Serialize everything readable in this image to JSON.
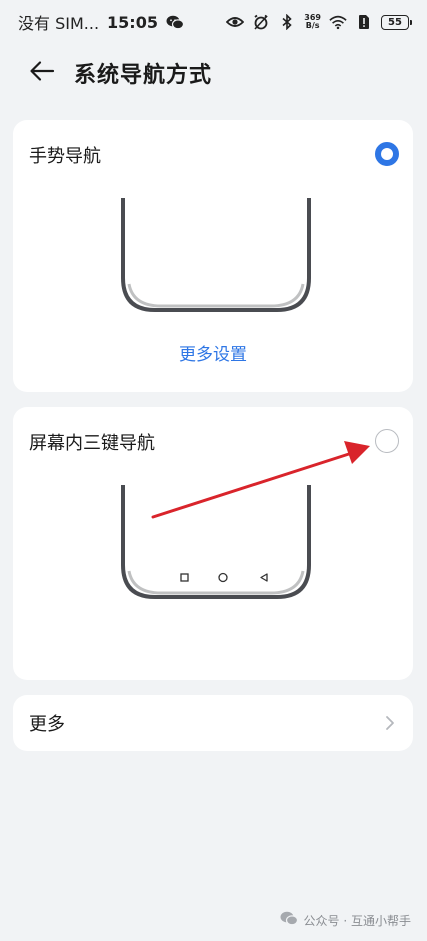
{
  "status_bar": {
    "carrier": "没有 SIM...",
    "time": "15:05",
    "net_speed_top": "369",
    "net_speed_bottom": "B/s",
    "battery": "55"
  },
  "header": {
    "title": "系统导航方式"
  },
  "options": {
    "gesture": {
      "label": "手势导航",
      "selected": true,
      "more_settings": "更多设置"
    },
    "three_key": {
      "label": "屏幕内三键导航",
      "selected": false
    }
  },
  "more": {
    "label": "更多"
  },
  "watermark": {
    "text": "公众号 · 互通小帮手"
  },
  "colors": {
    "accent": "#2e76e5",
    "annotation": "#d9242b"
  }
}
